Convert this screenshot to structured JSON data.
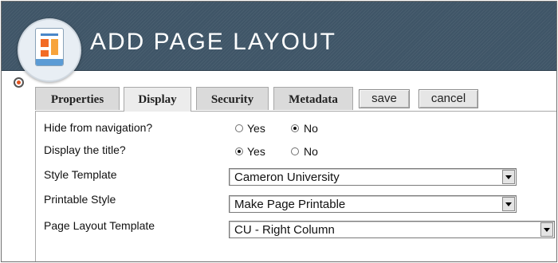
{
  "header": {
    "title": "ADD PAGE LAYOUT",
    "icon": "document-layout-icon"
  },
  "tabs": [
    {
      "label": "Properties",
      "active": false
    },
    {
      "label": "Display",
      "active": true
    },
    {
      "label": "Security",
      "active": false
    },
    {
      "label": "Metadata",
      "active": false
    }
  ],
  "actions": {
    "save_label": "save",
    "cancel_label": "cancel"
  },
  "form": {
    "hide_nav": {
      "label": "Hide from navigation?",
      "options": [
        "Yes",
        "No"
      ],
      "selected": "No"
    },
    "display_title": {
      "label": "Display the title?",
      "options": [
        "Yes",
        "No"
      ],
      "selected": "Yes"
    },
    "style_template": {
      "label": "Style Template",
      "value": "Cameron University"
    },
    "printable_style": {
      "label": "Printable Style",
      "value": "Make Page Printable"
    },
    "page_layout_template": {
      "label": "Page Layout Template",
      "value": "CU - Right Column"
    }
  },
  "colors": {
    "header_bg": "#3f5567",
    "accent_orange": "#f26b25"
  }
}
